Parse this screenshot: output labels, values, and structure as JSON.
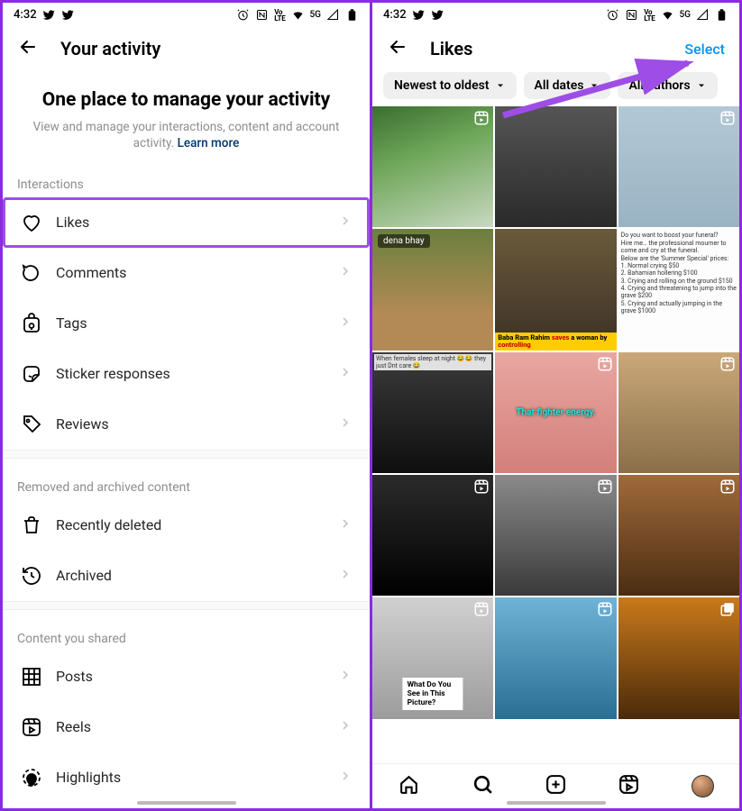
{
  "status": {
    "time": "4:32",
    "net_label": "5G",
    "volte_top": "Vo",
    "volte_bot": "LTE"
  },
  "left": {
    "header_title": "Your activity",
    "hero_title": "One place to manage your activity",
    "hero_sub": "View and manage your interactions, content and account activity. ",
    "hero_link": "Learn more",
    "sections": {
      "interactions": {
        "label": "Interactions",
        "items": [
          {
            "name": "likes",
            "label": "Likes",
            "highlight": true
          },
          {
            "name": "comments",
            "label": "Comments",
            "highlight": false
          },
          {
            "name": "tags",
            "label": "Tags",
            "highlight": false
          },
          {
            "name": "stickers",
            "label": "Sticker responses",
            "highlight": false
          },
          {
            "name": "reviews",
            "label": "Reviews",
            "highlight": false
          }
        ]
      },
      "removed": {
        "label": "Removed and archived content",
        "items": [
          {
            "name": "recently-deleted",
            "label": "Recently deleted"
          },
          {
            "name": "archived",
            "label": "Archived"
          }
        ]
      },
      "shared": {
        "label": "Content you shared",
        "items": [
          {
            "name": "posts",
            "label": "Posts"
          },
          {
            "name": "reels",
            "label": "Reels"
          },
          {
            "name": "highlights",
            "label": "Highlights"
          }
        ]
      }
    }
  },
  "right": {
    "header_title": "Likes",
    "action": "Select",
    "chips": [
      {
        "name": "sort",
        "label": "Newest to oldest"
      },
      {
        "name": "dates",
        "label": "All dates"
      },
      {
        "name": "authors",
        "label": "All authors"
      }
    ],
    "tiles": [
      {
        "name_tag": "",
        "caption": "",
        "badge": "reel",
        "cls": "t1"
      },
      {
        "name_tag": "",
        "caption": "",
        "badge": "",
        "cls": "t2"
      },
      {
        "name_tag": "",
        "caption": "",
        "badge": "reel",
        "cls": "t3"
      },
      {
        "name_tag": "dena bhay",
        "caption": "",
        "badge": "",
        "cls": "t4"
      },
      {
        "name_tag": "",
        "yellow": "Baba Ram Rahim saves a woman by controlling",
        "badge": "",
        "cls": "t5"
      },
      {
        "text_block": "Do you want to boost your funeral?\nHire me… the professional mourner to come and cry at the funeral.\nBelow are the 'Summer Special' prices:\n1. Normal crying $50\n2. Bahamian hollering $100\n3. Crying and rolling on the ground $150\n4. Crying and threatening to jump into the grave $200\n5. Crying and actually jumping in the grave $1000",
        "badge": "",
        "cls": "text"
      },
      {
        "top": "When females sleep at night 😂😂 they just Dnt care 😂",
        "caption": "",
        "badge": "",
        "cls": "t7"
      },
      {
        "mid": "That fighter energy.",
        "badge": "reel",
        "cls": "t8"
      },
      {
        "name_tag": "",
        "caption": "",
        "badge": "reel",
        "cls": "t9"
      },
      {
        "name_tag": "",
        "caption": "",
        "badge": "reel",
        "cls": "t10"
      },
      {
        "name_tag": "",
        "caption": "",
        "badge": "reel",
        "cls": "t11"
      },
      {
        "name_tag": "",
        "caption": "",
        "badge": "reel",
        "cls": "t12"
      },
      {
        "white": "What Do You See in This Picture?",
        "badge": "reel",
        "cls": "t13"
      },
      {
        "name_tag": "",
        "caption": "",
        "badge": "reel",
        "cls": "t14"
      },
      {
        "name_tag": "",
        "caption": "",
        "badge": "multi",
        "cls": "t15"
      }
    ]
  }
}
